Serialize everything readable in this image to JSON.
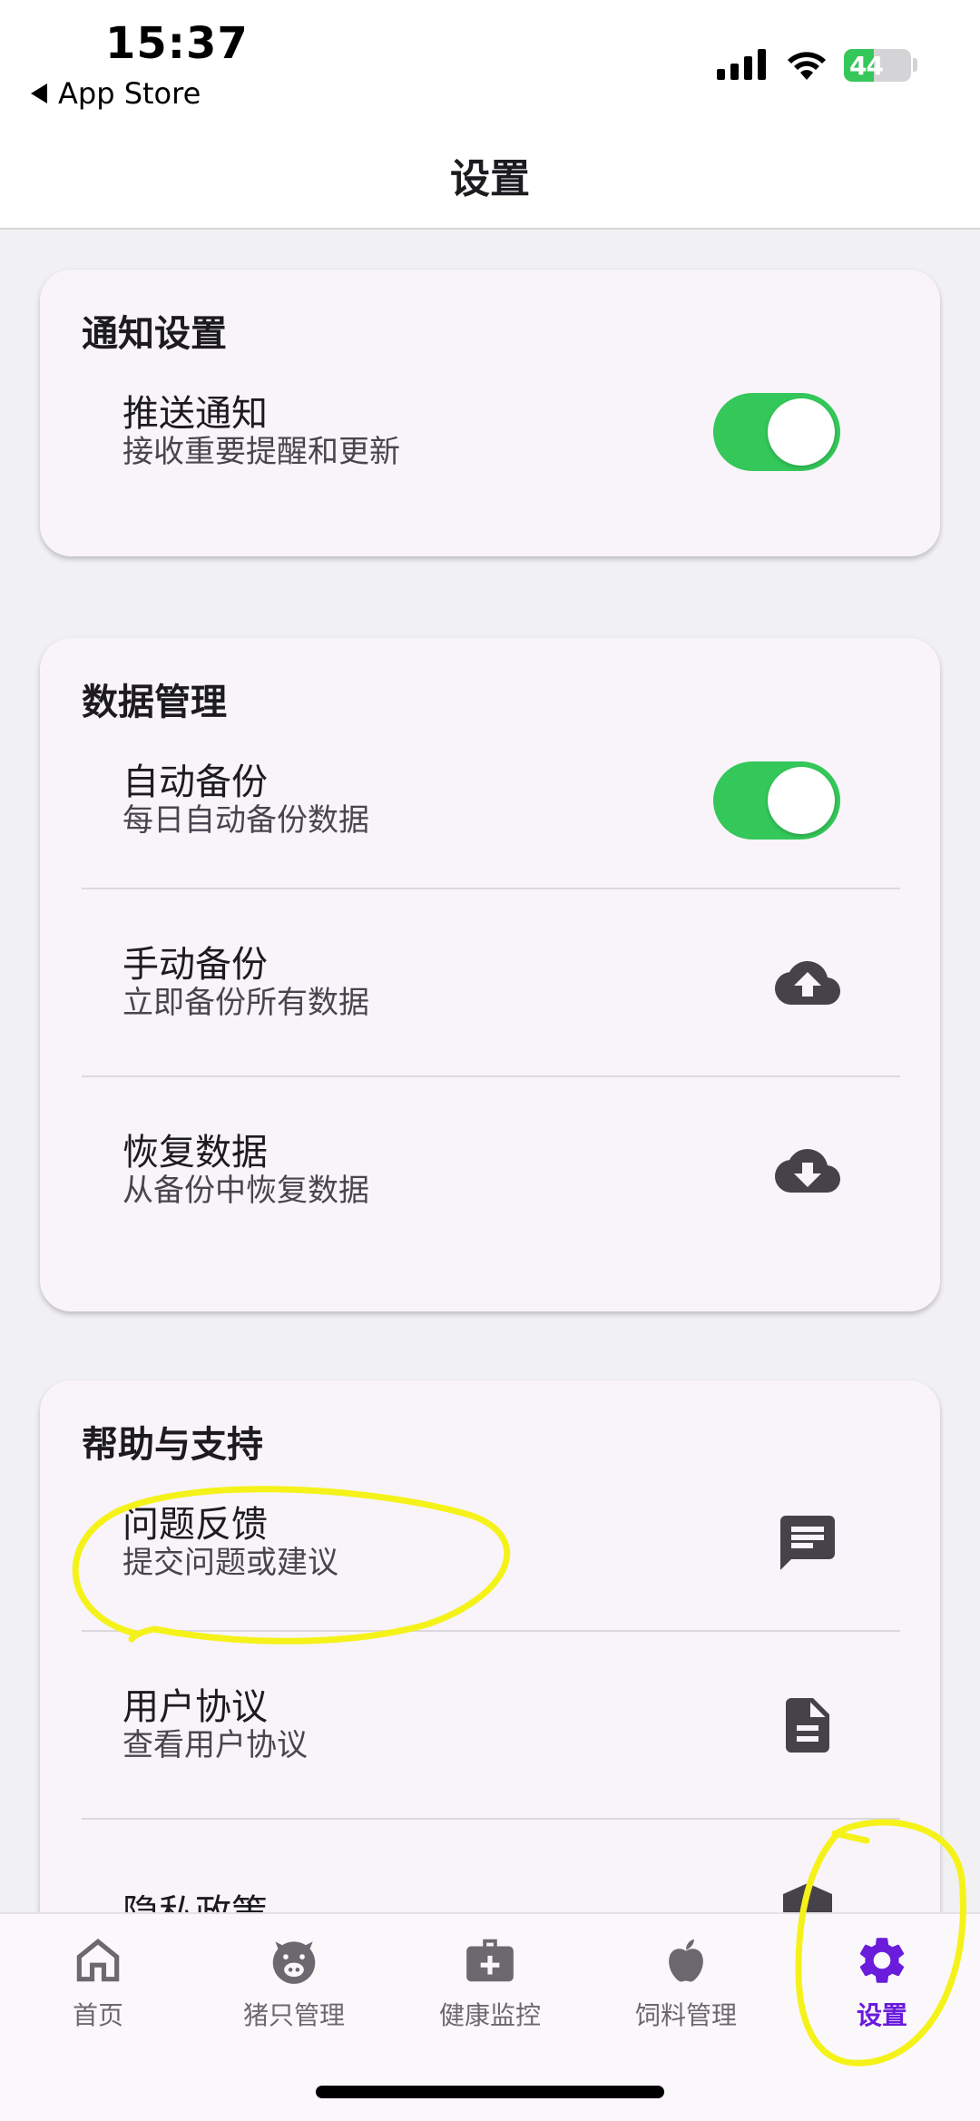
{
  "status_bar": {
    "time": "15:37",
    "back_label": "App Store",
    "battery": "44",
    "battery_level": 0.44
  },
  "app_bar": {
    "title": "设置"
  },
  "sections": {
    "notifications": {
      "title": "通知设置",
      "push": {
        "label": "推送通知",
        "subtitle": "接收重要提醒和更新",
        "enabled": true
      }
    },
    "data": {
      "title": "数据管理",
      "auto_backup": {
        "label": "自动备份",
        "subtitle": "每日自动备份数据",
        "enabled": true
      },
      "manual_backup": {
        "label": "手动备份",
        "subtitle": "立即备份所有数据",
        "icon": "cloud-upload-icon"
      },
      "restore": {
        "label": "恢复数据",
        "subtitle": "从备份中恢复数据",
        "icon": "cloud-download-icon"
      }
    },
    "help": {
      "title": "帮助与支持",
      "feedback": {
        "label": "问题反馈",
        "subtitle": "提交问题或建议",
        "icon": "feedback-icon"
      },
      "agreement": {
        "label": "用户协议",
        "subtitle": "查看用户协议",
        "icon": "document-icon"
      },
      "privacy": {
        "label": "隐私政策",
        "icon": "shield-icon"
      }
    }
  },
  "bottom_nav": {
    "items": [
      {
        "label": "首页",
        "icon": "home-icon"
      },
      {
        "label": "猪只管理",
        "icon": "pig-icon"
      },
      {
        "label": "健康监控",
        "icon": "medical-kit-icon"
      },
      {
        "label": "饲料管理",
        "icon": "apple-icon"
      },
      {
        "label": "设置",
        "icon": "gear-icon",
        "active": true
      }
    ]
  },
  "colors": {
    "accent": "#6a1bdc",
    "toggle_on": "#34c759",
    "highlight": "#f5f21a"
  }
}
